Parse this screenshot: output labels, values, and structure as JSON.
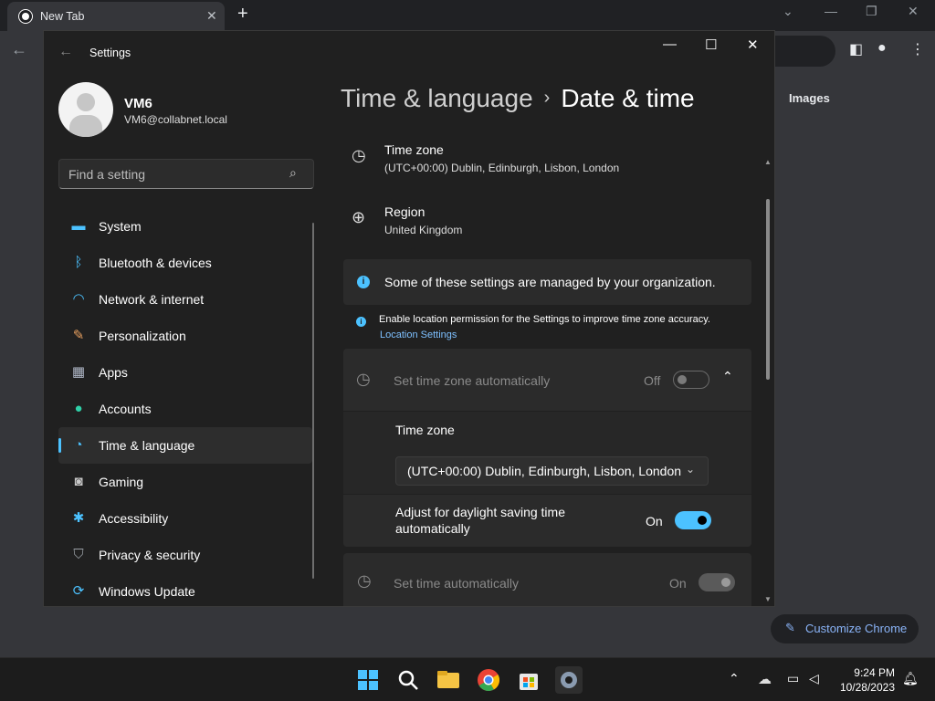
{
  "chrome": {
    "tab_title": "New Tab",
    "tab_close": "✕",
    "new_tab": "+",
    "images_link": "Images",
    "customize_label": "Customize Chrome"
  },
  "settings": {
    "window_title": "Settings",
    "user": {
      "name": "VM6",
      "email": "VM6@collabnet.local"
    },
    "search_placeholder": "Find a setting",
    "nav": [
      {
        "label": "System",
        "icon": "monitor-icon"
      },
      {
        "label": "Bluetooth & devices",
        "icon": "bluetooth-icon"
      },
      {
        "label": "Network & internet",
        "icon": "wifi-icon"
      },
      {
        "label": "Personalization",
        "icon": "brush-icon"
      },
      {
        "label": "Apps",
        "icon": "apps-icon"
      },
      {
        "label": "Accounts",
        "icon": "person-icon"
      },
      {
        "label": "Time & language",
        "icon": "globe-clock-icon",
        "selected": true
      },
      {
        "label": "Gaming",
        "icon": "gamepad-icon"
      },
      {
        "label": "Accessibility",
        "icon": "accessibility-icon"
      },
      {
        "label": "Privacy & security",
        "icon": "shield-icon"
      },
      {
        "label": "Windows Update",
        "icon": "update-icon"
      }
    ],
    "breadcrumb": {
      "parent": "Time & language",
      "separator": "›",
      "current": "Date & time"
    },
    "time_zone": {
      "label": "Time zone",
      "value": "(UTC+00:00) Dublin, Edinburgh, Lisbon, London"
    },
    "region": {
      "label": "Region",
      "value": "United Kingdom"
    },
    "managed_notice": "Some of these settings are managed by your organization.",
    "location_notice": "Enable location permission for the Settings to improve time zone accuracy.",
    "location_link": "Location Settings",
    "auto_timezone": {
      "label": "Set time zone automatically",
      "state": "Off"
    },
    "tz_dropdown": {
      "label": "Time zone",
      "selected": "(UTC+00:00) Dublin, Edinburgh, Lisbon, London"
    },
    "dst": {
      "label_line1": "Adjust for daylight saving time",
      "label_line2": "automatically",
      "state": "On"
    },
    "auto_time": {
      "label": "Set time automatically",
      "state": "On"
    }
  },
  "taskbar": {
    "time": "9:24 PM",
    "date": "10/28/2023"
  },
  "colors": {
    "accent": "#4cc2ff",
    "bg": "#202020",
    "card": "#2b2b2b"
  }
}
